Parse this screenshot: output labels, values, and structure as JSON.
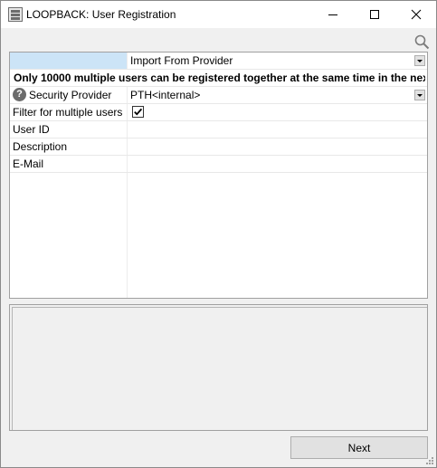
{
  "window": {
    "title": "LOOPBACK: User Registration",
    "controls": {
      "minimize": "minimize",
      "maximize": "maximize",
      "close": "close"
    }
  },
  "toolbar": {
    "search_icon": "search-icon"
  },
  "grid": {
    "import_row": {
      "label": "",
      "value": "Import From Provider"
    },
    "warning": "Only 10000 multiple users can be registered together at the same time in the nex...",
    "security_provider": {
      "label": "Security Provider",
      "value": "PTH<internal>"
    },
    "filter_multiple": {
      "label": "Filter for multiple users",
      "checked": true
    },
    "user_id": {
      "label": "User ID",
      "value": ""
    },
    "description": {
      "label": "Description",
      "value": ""
    },
    "email": {
      "label": "E-Mail",
      "value": ""
    }
  },
  "footer": {
    "next_label": "Next"
  },
  "colors": {
    "selection": "#cce4f7",
    "button": "#e1e1e1",
    "background": "#f0f0f0"
  }
}
